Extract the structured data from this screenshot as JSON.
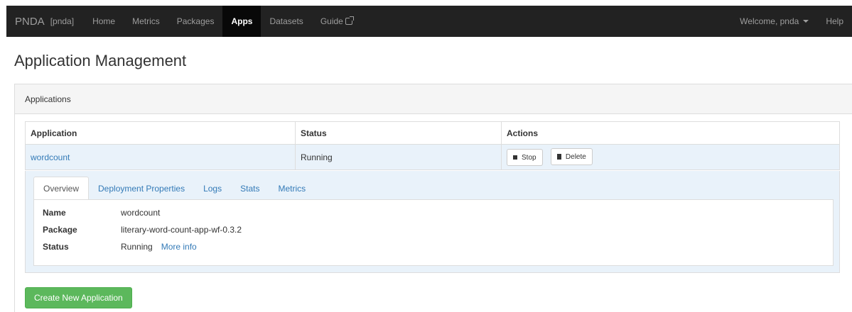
{
  "navbar": {
    "brand": "PNDA",
    "brand_sub": "[pnda]",
    "items": [
      {
        "label": "Home"
      },
      {
        "label": "Metrics"
      },
      {
        "label": "Packages"
      },
      {
        "label": "Apps"
      },
      {
        "label": "Datasets"
      },
      {
        "label": "Guide"
      }
    ],
    "active": "Apps",
    "welcome": "Welcome, pnda",
    "help": "Help"
  },
  "page": {
    "title": "Application Management"
  },
  "panel": {
    "heading": "Applications",
    "table": {
      "headers": [
        "Application",
        "Status",
        "Actions"
      ],
      "rows": [
        {
          "application": "wordcount",
          "status": "Running",
          "actions": [
            "Stop",
            "Delete"
          ]
        }
      ]
    },
    "detail": {
      "tabs": [
        "Overview",
        "Deployment Properties",
        "Logs",
        "Stats",
        "Metrics"
      ],
      "active_tab": "Overview",
      "fields": [
        {
          "key": "Name",
          "value": "wordcount"
        },
        {
          "key": "Package",
          "value": "literary-word-count-app-wf-0.3.2"
        },
        {
          "key": "Status",
          "value": "Running",
          "link": "More info"
        }
      ]
    }
  },
  "create_button": "Create New Application",
  "colors": {
    "navbar_bg": "#222222",
    "link": "#337ab7",
    "success": "#5cb85c",
    "row_highlight": "#e9f2fa"
  }
}
